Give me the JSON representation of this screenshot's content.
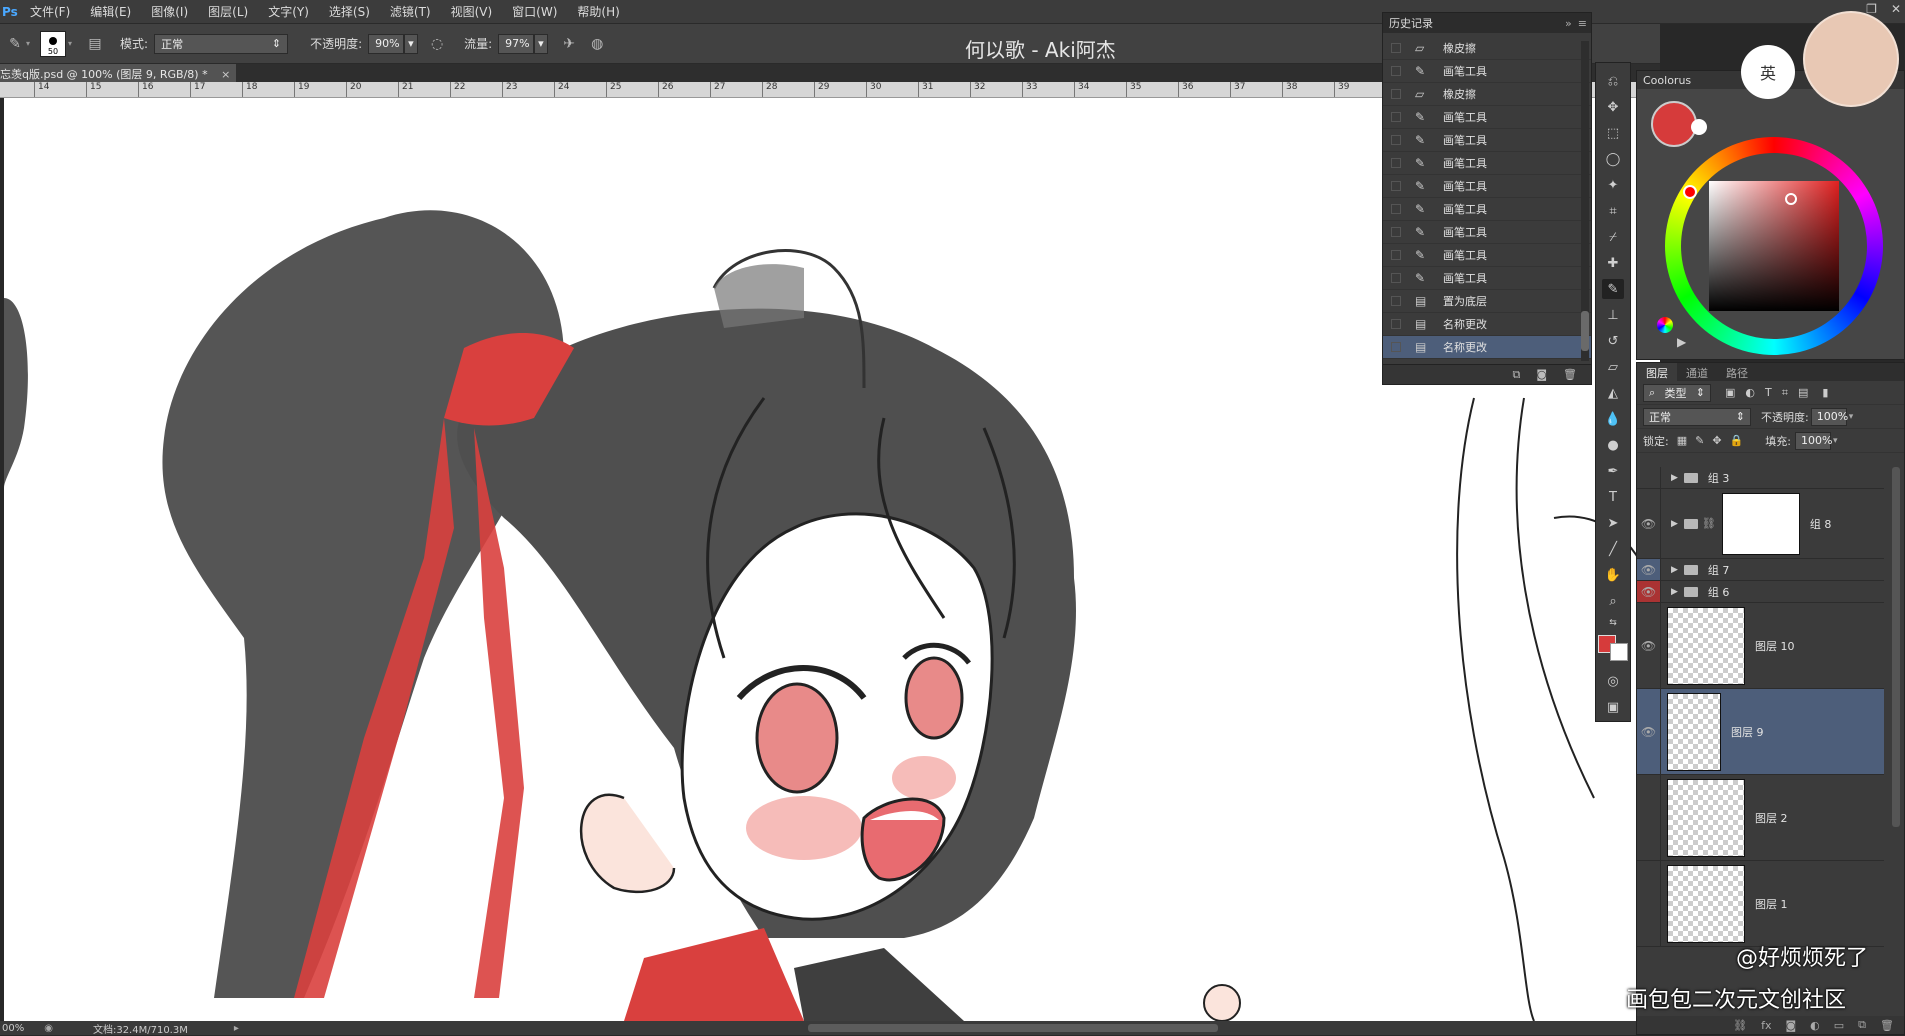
{
  "app": {
    "logo": "Ps"
  },
  "menu": [
    "文件(F)",
    "编辑(E)",
    "图像(I)",
    "图层(L)",
    "文字(Y)",
    "选择(S)",
    "滤镜(T)",
    "视图(V)",
    "窗口(W)",
    "帮助(H)"
  ],
  "options": {
    "brush_size": "50",
    "mode_label": "模式:",
    "mode_value": "正常",
    "opacity_label": "不透明度:",
    "opacity_value": "90%",
    "flow_label": "流量:",
    "flow_value": "97%"
  },
  "overlay_title": "何以歌 - Aki阿杰",
  "document_tab": "忘羡q版.psd @ 100% (图层 9, RGB/8) *",
  "ruler": [
    "14",
    "15",
    "16",
    "17",
    "18",
    "19",
    "20",
    "21",
    "22",
    "23",
    "24",
    "25",
    "26",
    "27",
    "28",
    "29",
    "30",
    "31",
    "32",
    "33",
    "34",
    "35",
    "36",
    "37",
    "38",
    "39"
  ],
  "status": {
    "zoom": "00%",
    "doc": "文档:32.4M/710.3M"
  },
  "history": {
    "title": "历史记录",
    "items": [
      {
        "label": "橡皮擦",
        "icon": "eraser-icon"
      },
      {
        "label": "画笔工具",
        "icon": "brush-icon"
      },
      {
        "label": "橡皮擦",
        "icon": "eraser-icon"
      },
      {
        "label": "画笔工具",
        "icon": "brush-icon"
      },
      {
        "label": "画笔工具",
        "icon": "brush-icon"
      },
      {
        "label": "画笔工具",
        "icon": "brush-icon"
      },
      {
        "label": "画笔工具",
        "icon": "brush-icon"
      },
      {
        "label": "画笔工具",
        "icon": "brush-icon"
      },
      {
        "label": "画笔工具",
        "icon": "brush-icon"
      },
      {
        "label": "画笔工具",
        "icon": "brush-icon"
      },
      {
        "label": "画笔工具",
        "icon": "brush-icon"
      },
      {
        "label": "置为底层",
        "icon": "layer-icon"
      },
      {
        "label": "名称更改",
        "icon": "layer-icon"
      },
      {
        "label": "名称更改",
        "icon": "layer-icon"
      }
    ]
  },
  "coolorus": {
    "title": "Coolorus",
    "ime": "英"
  },
  "layers": {
    "tabs": [
      "图层",
      "通道",
      "路径"
    ],
    "filter": "类型",
    "blend": "正常",
    "opacity_label": "不透明度:",
    "opacity_value": "100%",
    "lock_label": "锁定:",
    "fill_label": "填充:",
    "fill_value": "100%",
    "items": [
      {
        "name": "组 3",
        "type": "group"
      },
      {
        "name": "组 8",
        "type": "group-thumb"
      },
      {
        "name": "组 7",
        "type": "group"
      },
      {
        "name": "组 6",
        "type": "group"
      },
      {
        "name": "图层 10",
        "type": "layer"
      },
      {
        "name": "图层 9",
        "type": "layer"
      },
      {
        "name": "图层 2",
        "type": "layer"
      },
      {
        "name": "图层 1",
        "type": "layer"
      }
    ]
  },
  "colors": {
    "foreground": "#d63b3b",
    "background": "#ffffff",
    "accent": "#4d5e7a"
  },
  "credits": {
    "line1": "@好烦烦死了",
    "line2": "画包包二次元文创社区"
  }
}
